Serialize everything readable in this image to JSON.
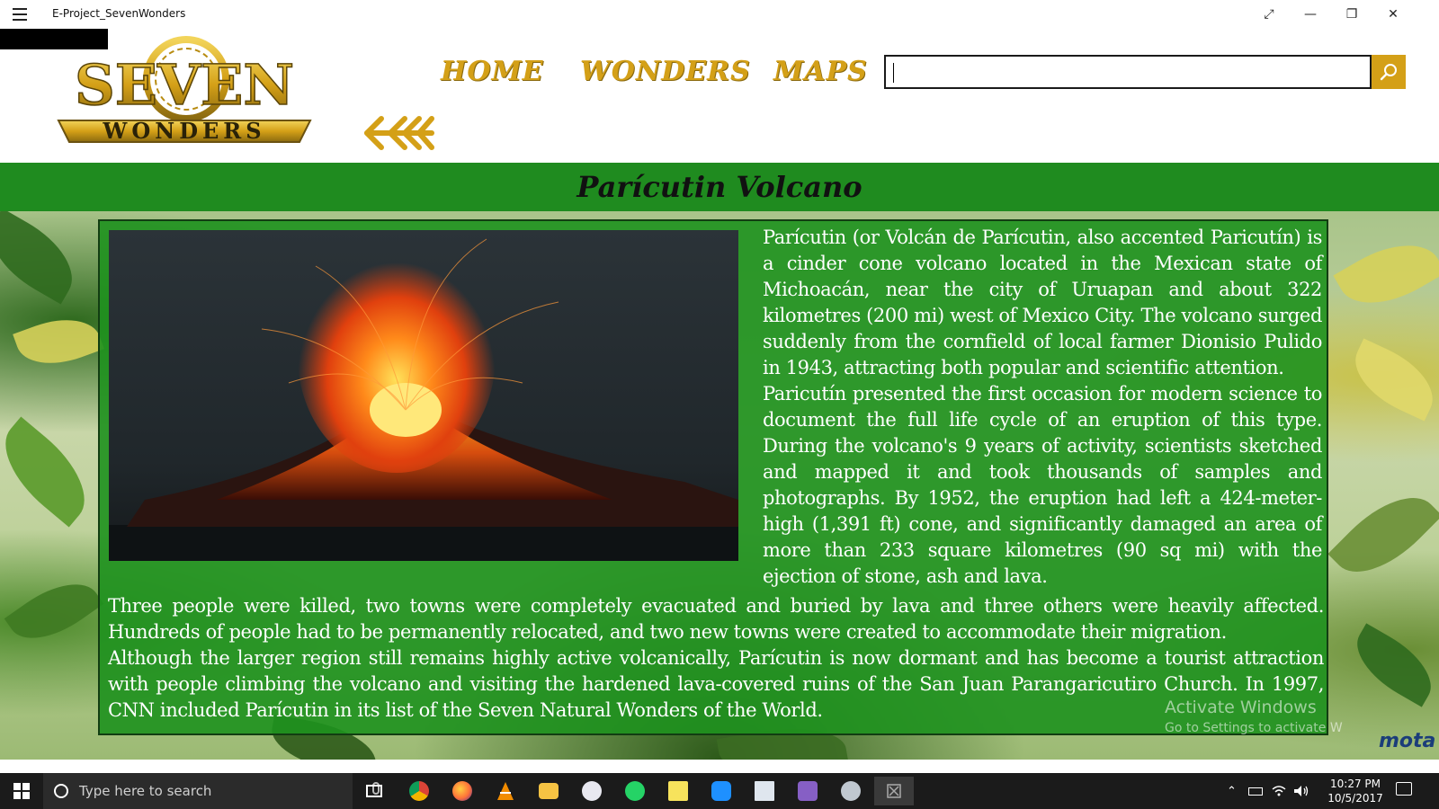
{
  "window": {
    "title": "E-Project_SevenWonders",
    "controls": [
      "⤢",
      "—",
      "❐",
      "✕"
    ]
  },
  "logo": {
    "word_top": "SEVEN",
    "word_bottom": "WONDERS",
    "color_gold": "#d4a017"
  },
  "nav": {
    "home": "HOME",
    "wonders": "WONDERS",
    "maps": "MAPS"
  },
  "search": {
    "value": "",
    "placeholder": ""
  },
  "page": {
    "title": "Parícutin Volcano",
    "paragraph_1": "Parícutin (or Volcán de Parícutin, also accented Paricutín) is a cinder cone volcano located in the Mexican state of Michoacán, near the city of Uruapan and about 322 kilometres (200 mi) west of Mexico City. The volcano surged suddenly from the cornfield of local farmer Dionisio Pulido in 1943, attracting both popular and scientific attention.",
    "paragraph_2": "Paricutín presented the first occasion for modern science to document the full life cycle of an eruption of this type. During the volcano's 9 years of activity, scientists sketched and mapped it and took thousands of samples and photographs. By 1952, the eruption had left a 424-meter-high (1,391 ft) cone, and significantly damaged an area of more than 233 square kilometres (90 sq mi) with the ejection of stone, ash and lava.",
    "paragraph_3": "Three people were killed, two towns were completely evacuated and buried by lava and three others were heavily affected. Hundreds of people had to be permanently relocated, and two new towns were created to accommodate their migration.",
    "paragraph_4": "Although the larger region still remains highly active volcanically, Parícutin is now dormant and has become a tourist attraction with people climbing the volcano and visiting the hardened lava-covered ruins of the San Juan Parangaricutiro Church. In 1997, CNN included Parícutin in its list of the Seven Natural Wonders of the World."
  },
  "watermark": {
    "line1": "Activate Windows",
    "line2": "Go to Settings to activate W",
    "brand": "mota"
  },
  "taskbar": {
    "search_placeholder": "Type here to search",
    "apps": [
      {
        "icon": "task-view-icon",
        "color": "#ffffff"
      },
      {
        "icon": "chrome-icon",
        "color": "#db4437"
      },
      {
        "icon": "firefox-icon",
        "color": "#ff7139"
      },
      {
        "icon": "vlc-icon",
        "color": "#f28c00"
      },
      {
        "icon": "file-explorer-icon",
        "color": "#f6c343"
      },
      {
        "icon": "paint-icon",
        "color": "#e8e8f0"
      },
      {
        "icon": "whatsapp-icon",
        "color": "#25d366"
      },
      {
        "icon": "sticky-notes-icon",
        "color": "#f7e35c"
      },
      {
        "icon": "messenger-icon",
        "color": "#1e90ff"
      },
      {
        "icon": "window-app-icon",
        "color": "#dfe6ee"
      },
      {
        "icon": "visual-studio-icon",
        "color": "#865fc5"
      },
      {
        "icon": "paint-palette-icon",
        "color": "#c0c8d0"
      },
      {
        "icon": "active-app-icon",
        "color": "#9a9a9a"
      }
    ],
    "time": "10:27 PM",
    "date": "10/5/2017"
  }
}
